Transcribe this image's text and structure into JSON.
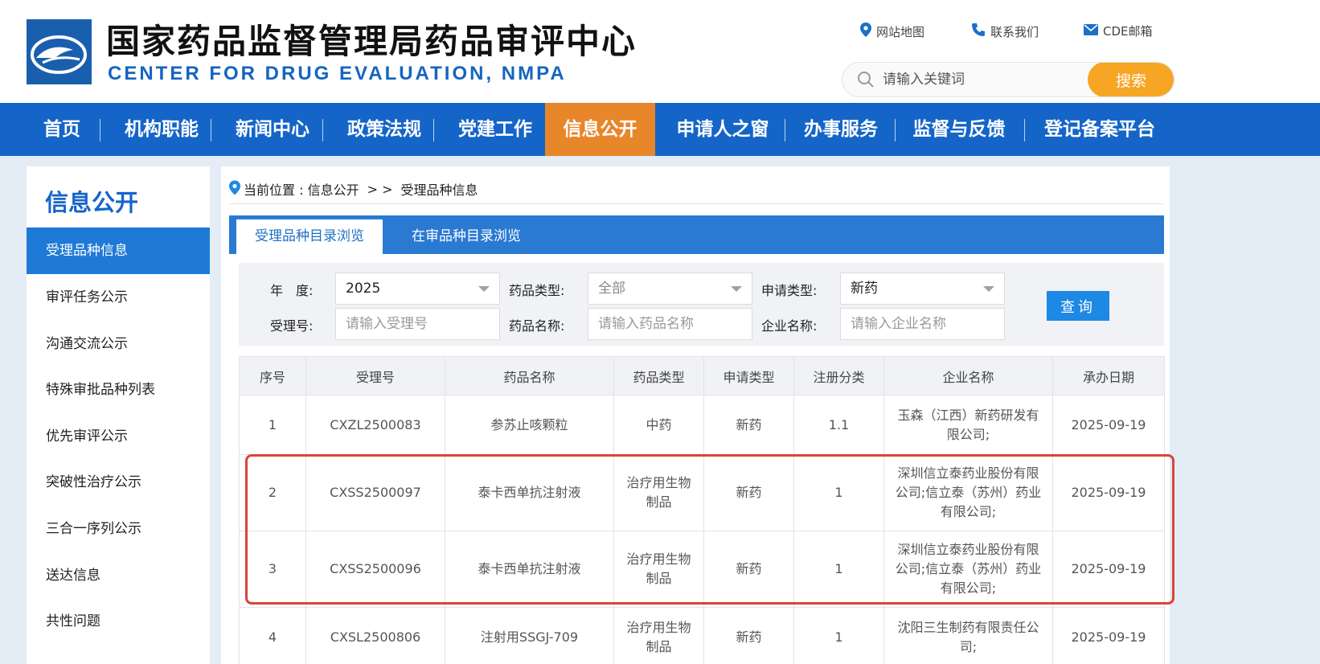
{
  "header": {
    "title_cn": "国家药品监督管理局药品审评中心",
    "title_en": "CENTER FOR DRUG EVALUATION, NMPA",
    "links": [
      {
        "label": "网站地图",
        "icon": "location-pin-icon"
      },
      {
        "label": "联系我们",
        "icon": "phone-icon"
      },
      {
        "label": "CDE邮箱",
        "icon": "mail-icon"
      }
    ],
    "search": {
      "placeholder": "请输入关键词",
      "button": "搜索"
    }
  },
  "nav": {
    "items": [
      "首页",
      "机构职能",
      "新闻中心",
      "政策法规",
      "党建工作",
      "信息公开",
      "申请人之窗",
      "办事服务",
      "监督与反馈",
      "登记备案平台"
    ],
    "active": "信息公开"
  },
  "sidebar": {
    "title": "信息公开",
    "items": [
      "受理品种信息",
      "审评任务公示",
      "沟通交流公示",
      "特殊审批品种列表",
      "优先审评公示",
      "突破性治疗公示",
      "三合一序列公示",
      "送达信息",
      "共性问题"
    ],
    "active": "受理品种信息"
  },
  "breadcrumb": {
    "prefix": "当前位置 : 信息公开",
    "sep": "> >",
    "current": "受理品种信息"
  },
  "tabs": [
    "受理品种目录浏览",
    "在审品种目录浏览"
  ],
  "filter": {
    "year_label": "年　度:",
    "year_value": "2025",
    "drug_type_label": "药品类型:",
    "drug_type_value": "全部",
    "app_type_label": "申请类型:",
    "app_type_value": "新药",
    "acceptance_label": "受理号:",
    "acceptance_placeholder": "请输入受理号",
    "drug_name_label": "药品名称:",
    "drug_name_placeholder": "请输入药品名称",
    "company_label": "企业名称:",
    "company_placeholder": "请输入企业名称",
    "query_button": "查询"
  },
  "table": {
    "headers": [
      "序号",
      "受理号",
      "药品名称",
      "药品类型",
      "申请类型",
      "注册分类",
      "企业名称",
      "承办日期"
    ],
    "rows": [
      [
        "1",
        "CXZL2500083",
        "参苏止咳颗粒",
        "中药",
        "新药",
        "1.1",
        "玉森（江西）新药研发有限公司;",
        "2025-09-19"
      ],
      [
        "2",
        "CXSS2500097",
        "泰卡西单抗注射液",
        "治疗用生物制品",
        "新药",
        "1",
        "深圳信立泰药业股份有限公司;信立泰（苏州）药业有限公司;",
        "2025-09-19"
      ],
      [
        "3",
        "CXSS2500096",
        "泰卡西单抗注射液",
        "治疗用生物制品",
        "新药",
        "1",
        "深圳信立泰药业股份有限公司;信立泰（苏州）药业有限公司;",
        "2025-09-19"
      ],
      [
        "4",
        "CXSL2500806",
        "注射用SSGJ-709",
        "治疗用生物制品",
        "新药",
        "1",
        "沈阳三生制药有限责任公司;",
        "2025-09-19"
      ]
    ]
  },
  "colors": {
    "nav_blue": "#1565c8",
    "active_orange": "#e8862a",
    "search_orange": "#f7a525",
    "highlight_red": "#d9453a"
  }
}
